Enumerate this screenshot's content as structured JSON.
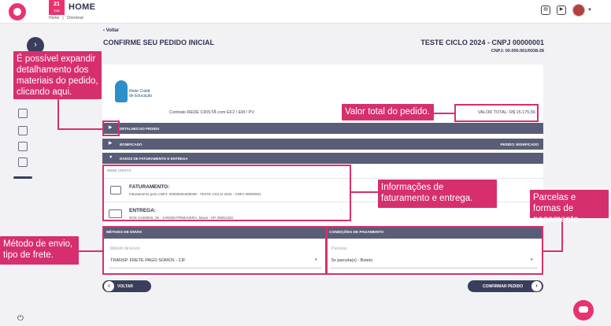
{
  "header": {
    "date_day": "21",
    "date_month": "Out",
    "title": "HOME",
    "breadcrumb": [
      "Home",
      "|",
      "Checkout"
    ]
  },
  "page": {
    "back_label": "Voltar",
    "title": "CONFIRME SEU PEDIDO INICIAL",
    "company": "TESTE CICLO 2024 - CNPJ 00000001",
    "cnpj": "CNPJ: 00.000.001/0038-28"
  },
  "brand": {
    "line1": "Rede Cristã",
    "line2": "de Educação"
  },
  "contract": "Contrato REDE CRISTÃ com EF2 / EM / PV",
  "total": "VALOR TOTAL: R$ 15.175,56",
  "accordions": {
    "details": "DETALHES DO PEDIDO",
    "bonificado": "BONIFICADO",
    "bonificado_right": "PEDIDO: BONIFICADO",
    "billing": "DADOS DE FATURAMENTO E ENTREGA"
  },
  "billing": {
    "network": "REDE CRISTÃ",
    "faturamento_title": "FATURAMENTO:",
    "faturamento_text": "Faturamento pelo CNPJ: 00000001900048 - TESTE CICLO 2024 - CNPJ 00000001",
    "entrega_title": "ENTREGA:",
    "entrega_text": "DOS JASMINS, 26 - JARDIM PRIMAVERA, Mauá - SP, 09361220"
  },
  "shipping": {
    "header": "MÉTODO DE ENVIO",
    "placeholder": "Método de Envio",
    "value": "TRANSP. FRETE PAGO SOMOS - CIF"
  },
  "payment": {
    "header": "CONDIÇÕES DE PAGAMENTO",
    "placeholder": "Parcelas",
    "value": "5x parcela(s) - Boleto"
  },
  "buttons": {
    "back": "VOLTAR",
    "confirm": "CONFIRMAR PEDIDO"
  },
  "annotations": {
    "expand": "É possível expandir detalhamento dos materiais do pedido, clicando aqui.",
    "total": "Valor total do pedido.",
    "billing": "Informações de faturamento e entrega.",
    "installments": "Parcelas e formas de pagamento.",
    "shipping": "Método de envio, tipo de frete."
  },
  "colors": {
    "accent": "#e8336f",
    "annotation": "#d72f6e",
    "dark": "#3a3d5c",
    "bar": "#595d77"
  }
}
